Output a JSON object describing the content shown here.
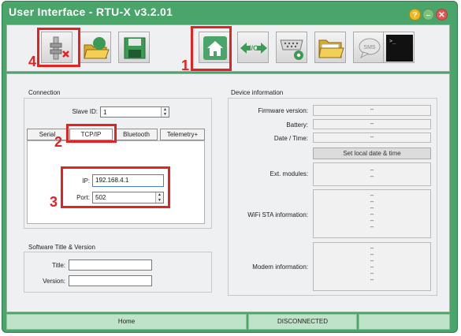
{
  "window": {
    "title": "User Interface - RTU-X v3.2.01",
    "buttons": {
      "help": "?",
      "minimize": "–",
      "close": "✕"
    }
  },
  "toolbar": {
    "buttons": [
      {
        "name": "disconnect"
      },
      {
        "name": "open-project"
      },
      {
        "name": "save"
      },
      {
        "name": "home"
      },
      {
        "name": "io"
      },
      {
        "name": "serial-config"
      },
      {
        "name": "open-folder"
      },
      {
        "name": "sms"
      },
      {
        "name": "console"
      }
    ],
    "io_label": "I/O",
    "sms_label": "SMS",
    "console_label": ">_"
  },
  "annotations": {
    "n1": "1",
    "n2": "2",
    "n3": "3",
    "n4": "4"
  },
  "connection": {
    "title": "Connection",
    "slave_id_label": "Slave ID:",
    "slave_id_value": "1",
    "tabs": [
      "Serial",
      "TCP/IP",
      "Bluetooth",
      "Telemetry+"
    ],
    "active_tab": "TCP/IP",
    "ip_label": "IP:",
    "ip_value": "192.168.4.1",
    "port_label": "Port:",
    "port_value": "502"
  },
  "software": {
    "title": "Software Title & Version",
    "title_label": "Title:",
    "title_value": "",
    "version_label": "Version:",
    "version_value": ""
  },
  "device": {
    "title": "Device information",
    "firmware_label": "Firmware version:",
    "firmware_value": "--",
    "battery_label": "Battery:",
    "battery_value": "--",
    "datetime_label": "Date / Time:",
    "datetime_value": "--",
    "set_date_button": "Set local date & time",
    "ext_modules_label": "Ext. modules:",
    "ext_modules_lines": [
      "--",
      "--"
    ],
    "wifi_label": "WiFi STA information:",
    "wifi_lines": [
      "--",
      "--",
      "--",
      "--",
      "--",
      "--"
    ],
    "modem_label": "Modem information:",
    "modem_lines": [
      "--",
      "--",
      "--",
      "--",
      "--",
      "--"
    ]
  },
  "statusbar": {
    "page": "Home",
    "connection": "DISCONNECTED",
    "extra": ""
  },
  "colors": {
    "accent_green": "#4aa56a",
    "highlight_red": "#e32222"
  }
}
